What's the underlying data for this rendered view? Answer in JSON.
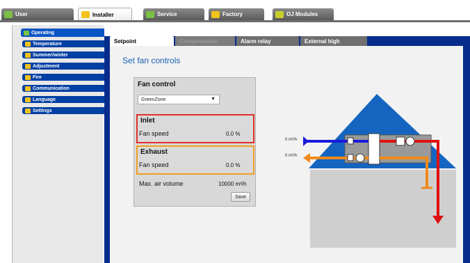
{
  "top_tabs": [
    {
      "label": "User"
    },
    {
      "label": "Installer"
    },
    {
      "label": "Service"
    },
    {
      "label": "Factory"
    },
    {
      "label": "OJ Modules"
    }
  ],
  "sidebar": {
    "items": [
      {
        "label": "Operating"
      },
      {
        "label": "Temperature"
      },
      {
        "label": "Summer/winter"
      },
      {
        "label": "Adjustment"
      },
      {
        "label": "Fire"
      },
      {
        "label": "Communication"
      },
      {
        "label": "Language"
      },
      {
        "label": "Settings"
      }
    ]
  },
  "sub_tabs": [
    {
      "label": "Setpoint"
    },
    {
      "label": "Compensation"
    },
    {
      "label": "Alarm relay"
    },
    {
      "label": "External high"
    }
  ],
  "page_title": "Set fan controls",
  "fan_control": {
    "title": "Fan control",
    "mode_select": "GreenZone",
    "inlet": {
      "heading": "Inlet",
      "label": "Fan speed",
      "value": "0.0 %"
    },
    "exhaust": {
      "heading": "Exhaust",
      "label": "Fan speed",
      "value": "0.0 %"
    },
    "max_air_label": "Max. air volume",
    "max_air_value": "10000 m³/h",
    "save_label": "Save"
  },
  "diagram": {
    "inlet_flow": "0 m³/h",
    "exhaust_flow": "0 m³/h",
    "colors": {
      "inlet": "#1a1adc",
      "exhaust": "#f08a1a",
      "supply": "#e01010",
      "roof": "#1565c0",
      "house": "#cfcfcf"
    }
  }
}
